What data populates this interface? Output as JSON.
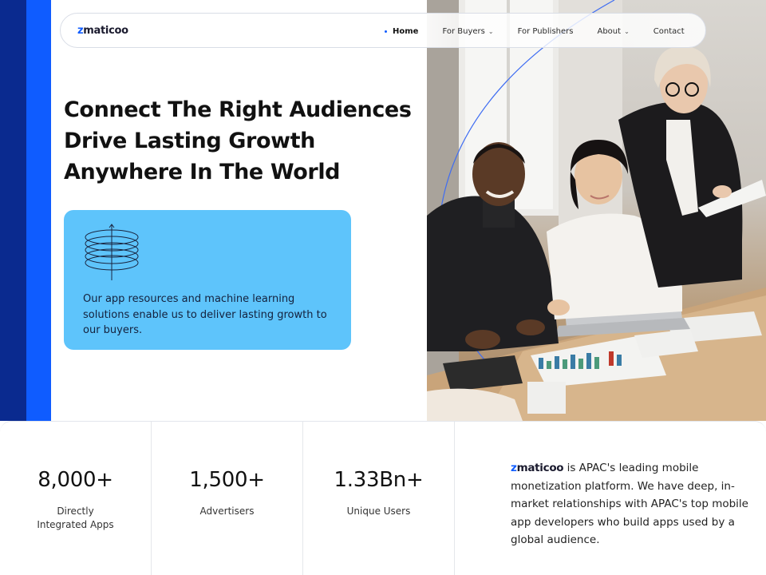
{
  "nav": {
    "logo_prefix": "z",
    "logo_rest": "maticoo",
    "items": [
      {
        "label": "Home",
        "active": true,
        "dropdown": false
      },
      {
        "label": "For Buyers",
        "active": false,
        "dropdown": true
      },
      {
        "label": "For Publishers",
        "active": false,
        "dropdown": false
      },
      {
        "label": "About",
        "active": false,
        "dropdown": true
      },
      {
        "label": "Contact",
        "active": false,
        "dropdown": false
      }
    ]
  },
  "hero": {
    "headline_lines": [
      "Connect The Right Audiences",
      "Drive Lasting Growth",
      "Anywhere In The World"
    ],
    "card_icon": "stacked-rings-icon",
    "card_text": "Our app resources and machine learning solutions enable us to deliver lasting growth to our buyers."
  },
  "stats": [
    {
      "value": "8,000+",
      "label_line1": "Directly",
      "label_line2": "Integrated Apps"
    },
    {
      "value": "1,500+",
      "label_line1": "Advertisers",
      "label_line2": ""
    },
    {
      "value": "1.33Bn+",
      "label_line1": "Unique Users",
      "label_line2": ""
    }
  ],
  "about": {
    "brand_prefix": "z",
    "brand_rest": "maticoo",
    "text": " is APAC's leading mobile monetization platform. We have deep, in-market relationships with APAC's top mobile app developers who build apps used by a global audience."
  },
  "colors": {
    "brand_blue": "#0f5cff",
    "dark_blue": "#0a2a8f",
    "card_blue": "#5ec4fb"
  }
}
